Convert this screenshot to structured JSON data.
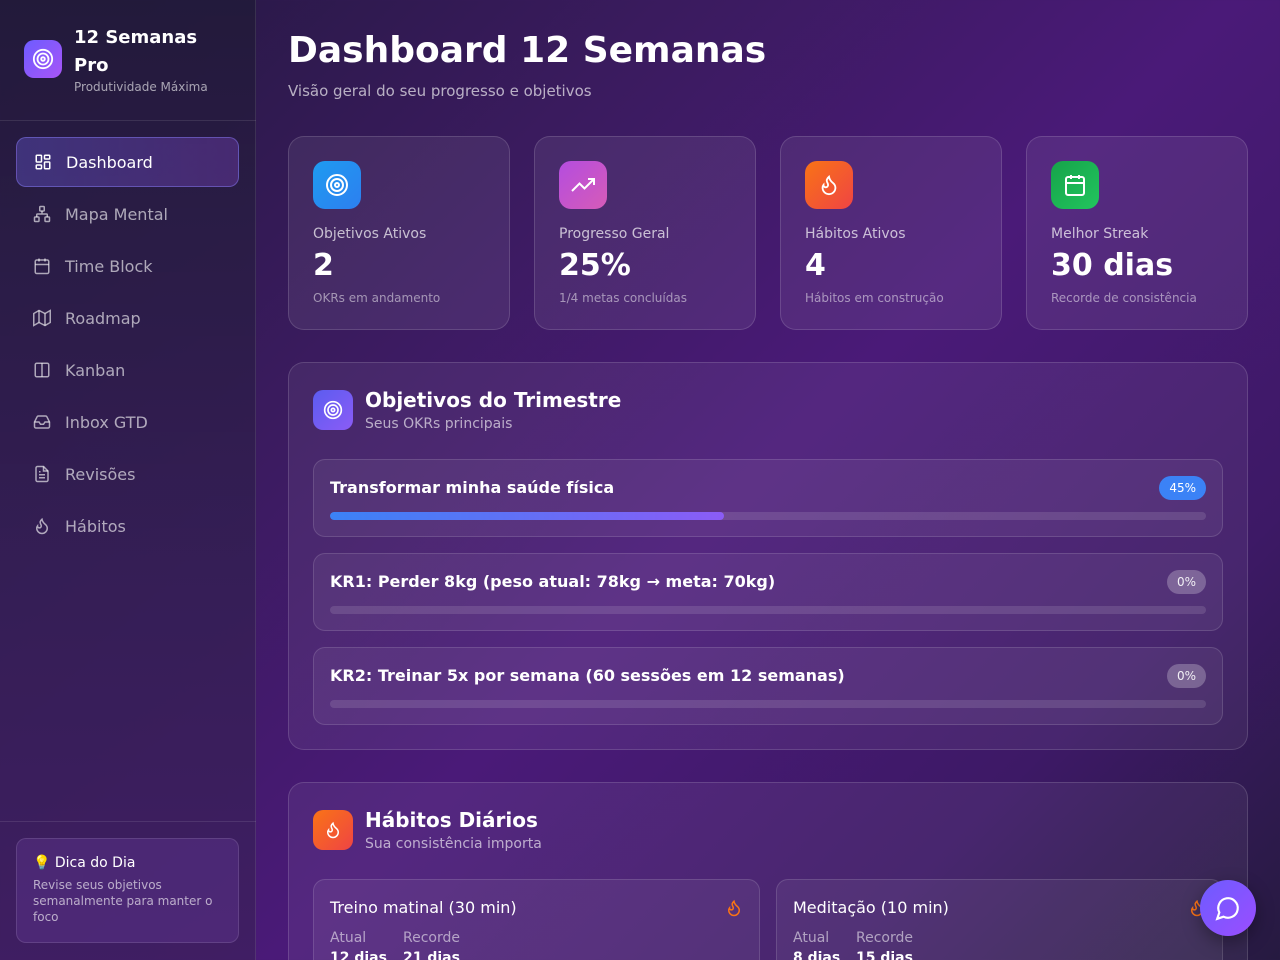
{
  "brand": {
    "title": "12 Semanas Pro",
    "subtitle": "Produtividade Máxima"
  },
  "sidebar": {
    "items": [
      {
        "label": "Dashboard",
        "icon": "dashboard-icon",
        "active": true
      },
      {
        "label": "Mapa Mental",
        "icon": "sitemap-icon"
      },
      {
        "label": "Time Block",
        "icon": "calendar-icon"
      },
      {
        "label": "Roadmap",
        "icon": "map-icon"
      },
      {
        "label": "Kanban",
        "icon": "columns-icon"
      },
      {
        "label": "Inbox GTD",
        "icon": "inbox-icon"
      },
      {
        "label": "Revisões",
        "icon": "document-icon"
      },
      {
        "label": "Hábitos",
        "icon": "flame-icon"
      }
    ],
    "tip": {
      "title": "💡 Dica do Dia",
      "text": "Revise seus objetivos semanalmente para manter o foco"
    }
  },
  "header": {
    "title": "Dashboard 12 Semanas",
    "subtitle": "Visão geral do seu progresso e objetivos"
  },
  "stats": [
    {
      "label": "Objetivos Ativos",
      "value": "2",
      "note": "OKRs em andamento",
      "icon": "target-icon",
      "color": "#1e9bf0"
    },
    {
      "label": "Progresso Geral",
      "value": "25%",
      "note": "1/4 metas concluídas",
      "icon": "trending-up-icon",
      "color": "#c04fd8"
    },
    {
      "label": "Hábitos Ativos",
      "value": "4",
      "note": "Hábitos em construção",
      "icon": "flame-icon",
      "color": "#f2562a"
    },
    {
      "label": "Melhor Streak",
      "value": "30 dias",
      "note": "Recorde de consistência",
      "icon": "calendar-icon",
      "color": "#18b865"
    }
  ],
  "objectives": {
    "title": "Objetivos do Trimestre",
    "subtitle": "Seus OKRs principais",
    "items": [
      {
        "title": "Transformar minha saúde física",
        "percent_label": "45%",
        "progress": 0.45
      },
      {
        "title": "KR1: Perder 8kg (peso atual: 78kg → meta: 70kg)",
        "percent_label": "0%",
        "progress": 0
      },
      {
        "title": "KR2: Treinar 5x por semana (60 sessões em 12 semanas)",
        "percent_label": "0%",
        "progress": 0
      }
    ]
  },
  "habits": {
    "title": "Hábitos Diários",
    "subtitle": "Sua consistência importa",
    "current_label": "Atual",
    "record_label": "Recorde",
    "items": [
      {
        "title": "Treino matinal (30 min)",
        "current": "12 dias",
        "record": "21 dias"
      },
      {
        "title": "Meditação (10 min)",
        "current": "8 dias",
        "record": "15 dias"
      }
    ]
  },
  "colors": {
    "accent": "#6d5cff",
    "progress_start": "#3b82f6",
    "progress_end": "#8b5cf6"
  }
}
